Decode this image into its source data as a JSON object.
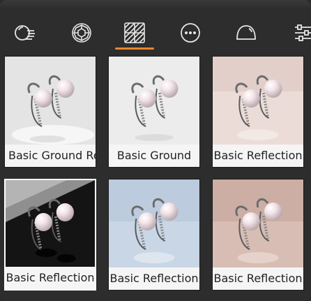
{
  "toolbar": {
    "tools": [
      {
        "icon": "light-rays-icon"
      },
      {
        "icon": "gem-icon"
      },
      {
        "icon": "hatched-grid-icon"
      },
      {
        "icon": "more-dots-icon"
      },
      {
        "icon": "dome-icon"
      },
      {
        "icon": "sliders-icon"
      }
    ],
    "active_index": 2,
    "accent_color": "#e8862f"
  },
  "presets": [
    {
      "label": "Basic Ground Re"
    },
    {
      "label": "Basic Ground"
    },
    {
      "label": "Basic Reflection"
    },
    {
      "label": "Basic Reflection"
    },
    {
      "label": "Basic Reflection"
    },
    {
      "label": "Basic Reflection"
    }
  ]
}
